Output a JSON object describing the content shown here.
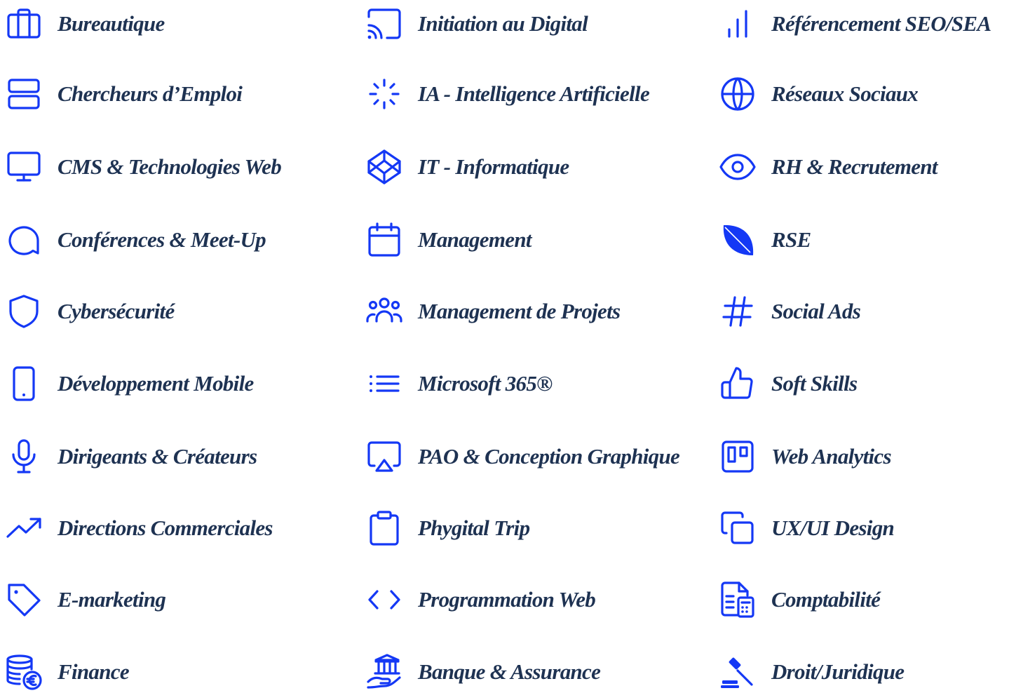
{
  "accent_color": "#1438f5",
  "text_color": "#1e3252",
  "columns": [
    {
      "items": [
        {
          "label": "Bureautique",
          "icon": "briefcase-icon"
        },
        {
          "label": "Chercheurs d’Emploi",
          "icon": "server-icon"
        },
        {
          "label": "CMS & Technologies Web",
          "icon": "monitor-icon"
        },
        {
          "label": "Conférences & Meet-Up",
          "icon": "chat-bubble-icon"
        },
        {
          "label": "Cybersécurité",
          "icon": "shield-icon"
        },
        {
          "label": "Développement Mobile",
          "icon": "smartphone-icon"
        },
        {
          "label": "Dirigeants & Créateurs",
          "icon": "microphone-icon"
        },
        {
          "label": "Directions Commerciales",
          "icon": "trending-up-icon"
        },
        {
          "label": "E-marketing",
          "icon": "tag-icon"
        },
        {
          "label": "Finance",
          "icon": "coins-euro-icon"
        }
      ]
    },
    {
      "items": [
        {
          "label": "Initiation au Digital",
          "icon": "cast-icon"
        },
        {
          "label": "IA - Intelligence Artificielle",
          "icon": "loader-icon"
        },
        {
          "label": "IT - Informatique",
          "icon": "codepen-icon"
        },
        {
          "label": "Management",
          "icon": "calendar-icon"
        },
        {
          "label": "Management de Projets",
          "icon": "users-group-icon"
        },
        {
          "label": "Microsoft 365®",
          "icon": "list-icon"
        },
        {
          "label": "PAO & Conception Graphique",
          "icon": "airplay-icon"
        },
        {
          "label": "Phygital Trip",
          "icon": "clipboard-icon"
        },
        {
          "label": "Programmation Web",
          "icon": "code-brackets-icon"
        },
        {
          "label": "Banque & Assurance",
          "icon": "bank-hand-icon"
        }
      ]
    },
    {
      "items": [
        {
          "label": "Référencement  SEO/SEA",
          "icon": "bar-chart-icon"
        },
        {
          "label": "Réseaux Sociaux",
          "icon": "globe-icon"
        },
        {
          "label": "RH & Recrutement",
          "icon": "eye-icon"
        },
        {
          "label": "RSE",
          "icon": "leaf-icon"
        },
        {
          "label": "Social Ads",
          "icon": "hashtag-icon"
        },
        {
          "label": "Soft Skills",
          "icon": "thumbs-up-icon"
        },
        {
          "label": "Web Analytics",
          "icon": "trello-icon"
        },
        {
          "label": "UX/UI Design",
          "icon": "copy-icon"
        },
        {
          "label": "Comptabilité",
          "icon": "accounting-document-icon"
        },
        {
          "label": "Droit/Juridique",
          "icon": "gavel-icon"
        }
      ]
    }
  ]
}
